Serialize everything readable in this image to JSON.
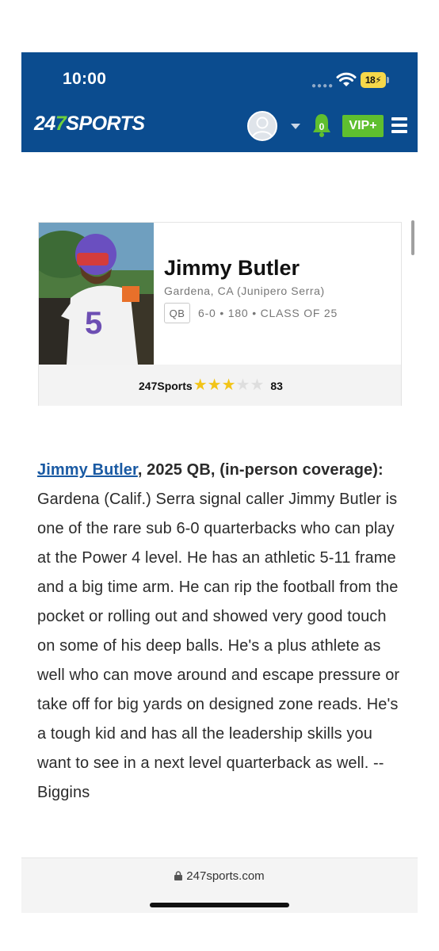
{
  "status_bar": {
    "time": "10:00",
    "battery": "18"
  },
  "header": {
    "logo_part1": "24",
    "logo_part2": "7",
    "logo_part3": "SPORTS",
    "notification_count": "0",
    "vip_label": "VIP+"
  },
  "player_card": {
    "name": "Jimmy Butler",
    "school": "Gardena, CA (Junipero Serra)",
    "position": "QB",
    "height": "6-0",
    "weight": "180",
    "class": "CLASS OF 25",
    "rating_label": "247Sports",
    "stars": 3,
    "max_stars": 5,
    "rating": "83"
  },
  "article": {
    "name_link": "Jimmy Butler",
    "lead_bold": ", 2025 QB, (in-person coverage):",
    "body": " Gardena (Calif.) Serra signal caller Jimmy Butler is one of the rare sub 6-0 quarterbacks who can play at the Power 4 level. He has an athletic 5-11 frame and a big time arm. He can rip the football from the pocket or rolling out and showed very good touch on some of his deep balls. He's a plus athlete as well who can move around and escape pressure or take off for big yards on designed zone reads. He's a tough kid and has all the leadership skills you want to see in a next level quarterback as well. -- Biggins"
  },
  "browser": {
    "url": "247sports.com"
  },
  "colors": {
    "header_bg": "#0b4c8f",
    "brand_green": "#5fbf2f",
    "link": "#1a5aa3",
    "star": "#f2c418"
  }
}
